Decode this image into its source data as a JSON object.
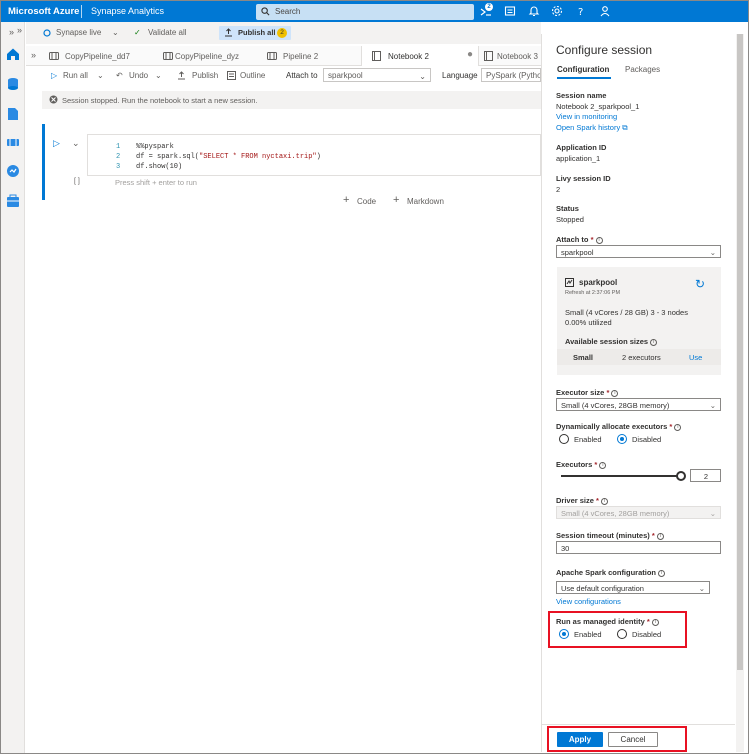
{
  "topbar": {
    "brand": "Microsoft Azure",
    "service": "Synapse Analytics",
    "search_placeholder": "Search",
    "notification_count": "2",
    "icons": [
      "cloud-shell-icon",
      "directory-filter-icon",
      "notifications-icon",
      "settings-icon",
      "help-icon",
      "feedback-icon"
    ]
  },
  "rail": {
    "collapse": "»",
    "items": [
      "home-icon",
      "data-icon",
      "develop-icon",
      "integrate-icon",
      "monitor-icon",
      "manage-icon"
    ]
  },
  "command_bar": {
    "expand": "»",
    "mode": "Synapse live",
    "validate": "Validate all",
    "publish_all": "Publish all",
    "publish_count": "2"
  },
  "tabs": {
    "expand": "»",
    "items": [
      {
        "label": "CopyPipeline_dd7",
        "icon": "pipeline-icon"
      },
      {
        "label": "CopyPipeline_dyz",
        "icon": "pipeline-icon"
      },
      {
        "label": "Pipeline 2",
        "icon": "pipeline-icon"
      },
      {
        "label": "Notebook 2",
        "icon": "notebook-icon",
        "active": true
      },
      {
        "label": "Notebook 3",
        "icon": "notebook-icon"
      }
    ]
  },
  "toolbar": {
    "run_all": "Run all",
    "undo": "Undo",
    "publish": "Publish",
    "outline": "Outline",
    "attach_to_label": "Attach to",
    "attach_to_value": "sparkpool",
    "language_label": "Language",
    "language_value": "PySpark (Python)"
  },
  "session_message": "Session stopped. Run the notebook to start a new session.",
  "cell": {
    "lines": [
      {
        "n": "1",
        "code": "%%pyspark"
      },
      {
        "n": "2",
        "code_pre": "df = spark.sql(",
        "code_str": "\"SELECT * FROM nyctaxi.trip\"",
        "code_post": ")"
      },
      {
        "n": "3",
        "code": "df.show(10)"
      }
    ],
    "exec_count": "[ ]",
    "hint": "Press shift + enter to run",
    "add_code": "Code",
    "add_markdown": "Markdown"
  },
  "panel": {
    "title": "Configure session",
    "tab_config": "Configuration",
    "tab_packages": "Packages",
    "session_name_label": "Session name",
    "session_name_value": "Notebook 2_sparkpool_1",
    "view_in_monitoring": "View in monitoring",
    "open_spark_history": "Open Spark history",
    "application_id_label": "Application ID",
    "application_id_value": "application_1",
    "livy_id_label": "Livy session ID",
    "livy_id_value": "2",
    "status_label": "Status",
    "status_value": "Stopped",
    "attach_to_label": "Attach to",
    "attach_to_value": "sparkpool",
    "pool_card": {
      "name": "sparkpool",
      "refresh": "Refresh at 2:37:06 PM",
      "size": "Small (4 vCores / 28 GB) 3 - 3 nodes",
      "utilized": "0.00% utilized",
      "available_label": "Available session sizes",
      "row_size": "Small",
      "row_executors": "2 executors",
      "row_action": "Use"
    },
    "executor_size_label": "Executor size",
    "executor_size_value": "Small (4 vCores, 28GB memory)",
    "dyn_alloc_label": "Dynamically allocate executors",
    "dyn_enabled": "Enabled",
    "dyn_disabled": "Disabled",
    "executors_label": "Executors",
    "executors_value": "2",
    "executors_slider_fraction": 1.0,
    "driver_size_label": "Driver size",
    "driver_size_value": "Small (4 vCores, 28GB memory)",
    "timeout_label": "Session timeout (minutes)",
    "timeout_value": "30",
    "spark_config_label": "Apache Spark configuration",
    "spark_config_value": "Use default configuration",
    "view_configurations": "View configurations",
    "managed_identity_label": "Run as managed identity",
    "mi_enabled": "Enabled",
    "mi_disabled": "Disabled",
    "apply": "Apply",
    "cancel": "Cancel"
  },
  "colors": {
    "accent": "#0078d4",
    "highlight": "#e81123",
    "badge": "#f0c000"
  }
}
